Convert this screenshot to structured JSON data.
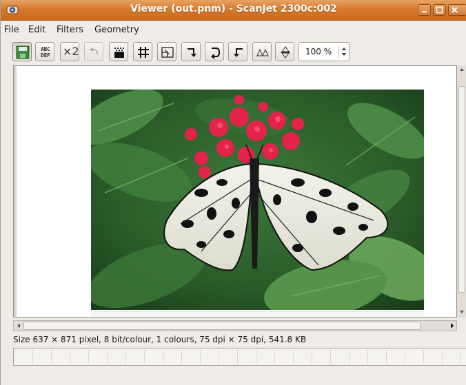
{
  "window": {
    "title": "Viewer (out.pnm) - ScanJet 2300c:002",
    "controls": [
      "minimize-icon",
      "maximize-icon",
      "close-icon"
    ],
    "accent_color": "#d97a2d"
  },
  "menubar": {
    "items": [
      "File",
      "Edit",
      "Filters",
      "Geometry"
    ]
  },
  "toolbar": {
    "buttons": [
      {
        "name": "save-button",
        "icon": "save-icon"
      },
      {
        "name": "ocr-button",
        "icon": "abc-def-icon",
        "label_line1": "ABC",
        "label_line2": "DEF"
      },
      {
        "name": "zoom-x2-button",
        "icon": "multiply-two-icon",
        "label": "×2"
      },
      {
        "name": "undo-button",
        "icon": "undo-icon"
      },
      {
        "name": "despeckle-button",
        "icon": "dots-icon"
      },
      {
        "name": "grid-button",
        "icon": "grid-icon"
      },
      {
        "name": "crop-button",
        "icon": "crop-icon"
      },
      {
        "name": "rotate-cw-button",
        "icon": "rotate-clockwise-icon"
      },
      {
        "name": "rotate-180-button",
        "icon": "rotate-180-icon"
      },
      {
        "name": "rotate-ccw-button",
        "icon": "rotate-counterclockwise-icon"
      },
      {
        "name": "mirror-horizontal-button",
        "icon": "mirror-horizontal-icon"
      },
      {
        "name": "mirror-vertical-button",
        "icon": "mirror-vertical-icon"
      }
    ],
    "zoom": {
      "value": "100 %"
    }
  },
  "image": {
    "subject": "butterfly-on-flowers-photo"
  },
  "status": {
    "info": "Size 637 × 871 pixel, 8 bit/colour, 1 colours, 75 dpi × 75 dpi, 541.8 KB"
  },
  "progress": {
    "value": 0
  }
}
